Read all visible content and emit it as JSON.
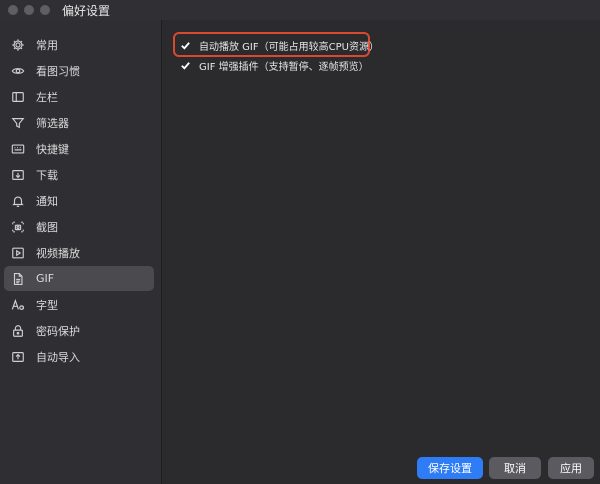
{
  "window": {
    "title": "偏好设置"
  },
  "sidebar": {
    "items": [
      {
        "label": "常用",
        "icon": "gear-icon",
        "active": false
      },
      {
        "label": "看图习惯",
        "icon": "eye-icon",
        "active": false
      },
      {
        "label": "左栏",
        "icon": "left-panel-icon",
        "active": false
      },
      {
        "label": "筛选器",
        "icon": "filter-icon",
        "active": false
      },
      {
        "label": "快捷键",
        "icon": "keyboard-icon",
        "active": false
      },
      {
        "label": "下载",
        "icon": "download-icon",
        "active": false
      },
      {
        "label": "通知",
        "icon": "bell-icon",
        "active": false
      },
      {
        "label": "截图",
        "icon": "screenshot-icon",
        "active": false
      },
      {
        "label": "视频播放",
        "icon": "play-icon",
        "active": false
      },
      {
        "label": "GIF",
        "icon": "gif-file-icon",
        "active": true
      },
      {
        "label": "字型",
        "icon": "font-icon",
        "active": false
      },
      {
        "label": "密码保护",
        "icon": "lock-icon",
        "active": false
      },
      {
        "label": "自动导入",
        "icon": "import-icon",
        "active": false
      }
    ]
  },
  "main": {
    "options": [
      {
        "label": "自动播放 GIF（可能占用较高CPU资源）",
        "checked": true,
        "highlighted": true
      },
      {
        "label": "GIF 增强插件（支持暂停、逐帧预览）",
        "checked": true,
        "highlighted": false
      }
    ]
  },
  "footer": {
    "save_label": "保存设置",
    "cancel_label": "取消",
    "apply_label": "应用"
  },
  "colors": {
    "accent": "#2e7cf6",
    "highlight": "#d84a2f",
    "background": "#2b2b2e",
    "sidebar_bg": "#2f2f33",
    "active_item": "#4a4a4f"
  }
}
